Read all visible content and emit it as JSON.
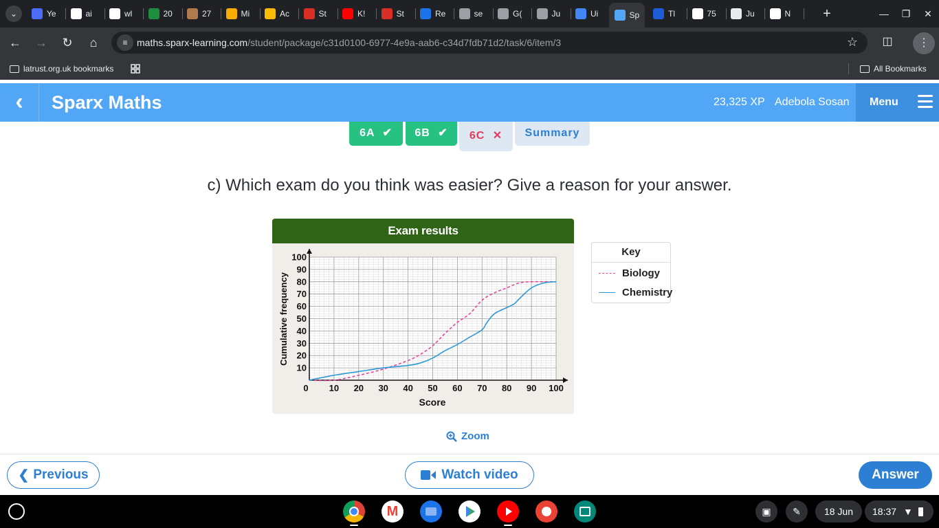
{
  "browser": {
    "tabs": [
      {
        "label": "Ye",
        "color": "#4a6cf7"
      },
      {
        "label": "ai",
        "color": "#ffffff"
      },
      {
        "label": "wl",
        "color": "#ffffff"
      },
      {
        "label": "20",
        "color": "#1e8e3e"
      },
      {
        "label": "27",
        "color": "#b07a4d"
      },
      {
        "label": "Mi",
        "color": "#f9ab00"
      },
      {
        "label": "Ac",
        "color": "#fbbc04"
      },
      {
        "label": "St",
        "color": "#d93025"
      },
      {
        "label": "K!",
        "color": "#ff0000"
      },
      {
        "label": "St",
        "color": "#d93025"
      },
      {
        "label": "Re",
        "color": "#1a73e8"
      },
      {
        "label": "se",
        "color": "#9aa0a6"
      },
      {
        "label": "G(",
        "color": "#9aa0a6"
      },
      {
        "label": "Ju",
        "color": "#9aa0a6"
      },
      {
        "label": "Ui",
        "color": "#4285f4"
      },
      {
        "label": "Sp",
        "color": "#51a6f5"
      },
      {
        "label": "Tl",
        "color": "#1e5bd6"
      },
      {
        "label": "75",
        "color": "#ffffff"
      },
      {
        "label": "Ju",
        "color": "#e8eaed"
      },
      {
        "label": "N",
        "color": "#ffffff"
      }
    ],
    "url_host": "maths.sparx-learning.com",
    "url_path": "/student/package/c31d0100-6977-4e9a-aab6-c34d7fdb71d2/task/6/item/3",
    "bookmark_folder": "latrust.org.uk bookmarks",
    "all_bookmarks": "All Bookmarks"
  },
  "header": {
    "brand": "Sparx Maths",
    "xp": "23,325 XP",
    "user": "Adebola Sosan",
    "menu": "Menu"
  },
  "task_tabs": {
    "tab_a": "6A",
    "tab_b": "6B",
    "tab_c": "6C",
    "summary": "Summary"
  },
  "question": "c) Which exam do you think was easier? Give a reason for your answer.",
  "chart_data": {
    "type": "line",
    "title": "Exam results",
    "xlabel": "Score",
    "ylabel": "Cumulative frequency",
    "xlim": [
      0,
      100
    ],
    "ylim": [
      0,
      100
    ],
    "x_ticks": [
      0,
      10,
      20,
      30,
      40,
      50,
      60,
      70,
      80,
      90,
      100
    ],
    "y_ticks": [
      10,
      20,
      30,
      40,
      50,
      60,
      70,
      80,
      90,
      100
    ],
    "grid": true,
    "legend_title": "Key",
    "series": [
      {
        "name": "Biology",
        "style": "dashed",
        "color": "#e8439a",
        "x": [
          0,
          10,
          20,
          30,
          40,
          45,
          50,
          55,
          60,
          65,
          70,
          75,
          80,
          85,
          90,
          95,
          100
        ],
        "y": [
          0,
          0,
          4,
          9,
          16,
          21,
          28,
          38,
          47,
          54,
          65,
          71,
          75,
          79,
          80,
          80,
          80
        ]
      },
      {
        "name": "Chemistry",
        "style": "solid",
        "color": "#2a9ad6",
        "x": [
          0,
          10,
          20,
          30,
          40,
          45,
          50,
          55,
          60,
          65,
          70,
          72,
          75,
          80,
          83,
          85,
          90,
          95,
          100
        ],
        "y": [
          0,
          4,
          7,
          10,
          12,
          14,
          18,
          24,
          29,
          35,
          41,
          47,
          54,
          59,
          62,
          66,
          75,
          79,
          80
        ]
      }
    ]
  },
  "zoom_label": "Zoom",
  "footer": {
    "previous": "Previous",
    "watch_video": "Watch video",
    "answer": "Answer"
  },
  "shelf": {
    "date": "18 Jun",
    "time": "18:37"
  }
}
